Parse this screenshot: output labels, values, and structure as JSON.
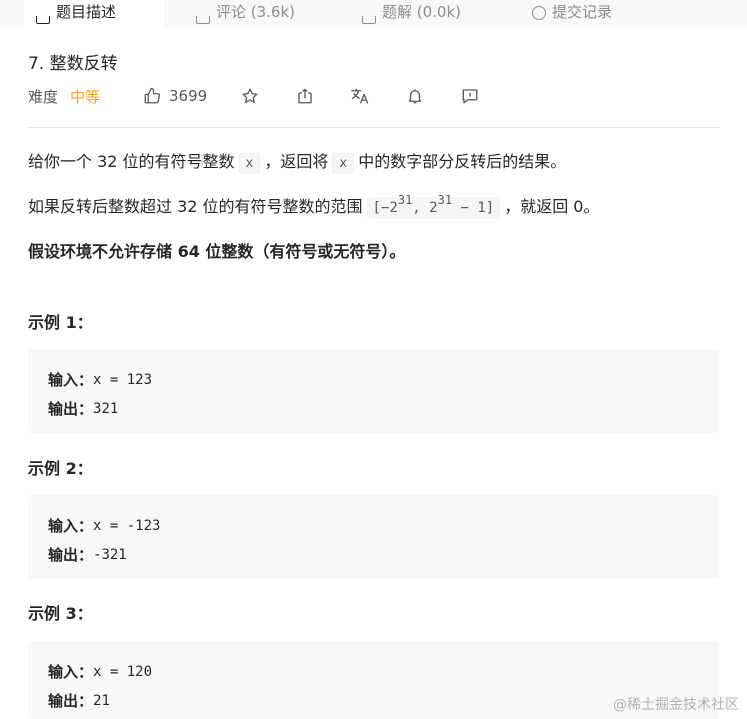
{
  "tabs": [
    {
      "label": "题目描述",
      "active": true
    },
    {
      "label": "评论 (3.6k)",
      "active": false
    },
    {
      "label": "题解 (0.0k)",
      "active": false
    },
    {
      "label": "提交记录",
      "active": false
    }
  ],
  "problem": {
    "title": "7. 整数反转",
    "difficulty_label": "难度",
    "difficulty": "中等",
    "likes": "3699"
  },
  "icons": [
    "thumb-up-icon",
    "star-icon",
    "share-icon",
    "translate-icon",
    "bell-icon",
    "feedback-icon"
  ],
  "description": {
    "p1_a": "给你一个 32 位的有符号整数",
    "p1_code1": "x",
    "p1_b": "，返回将",
    "p1_code2": "x",
    "p1_c": "中的数字部分反转后的结果。",
    "p2_a": "如果反转后整数超过 32 位的有符号整数的范围",
    "p2_range_open": "[−2",
    "p2_exp1": "31",
    "p2_range_mid": ",  2",
    "p2_exp2": "31",
    "p2_range_close": " − 1]",
    "p2_b": "，就返回 0。",
    "p3": "假设环境不允许存储 64 位整数（有符号或无符号）。"
  },
  "examples": [
    {
      "title": "示例 1：",
      "input_label": "输入：",
      "input": "x = 123",
      "output_label": "输出：",
      "output": "321"
    },
    {
      "title": "示例 2：",
      "input_label": "输入：",
      "input": "x = -123",
      "output_label": "输出：",
      "output": "-321"
    },
    {
      "title": "示例 3：",
      "input_label": "输入：",
      "input": "x = 120",
      "output_label": "输出：",
      "output": "21"
    }
  ],
  "watermark": "@稀土掘金技术社区",
  "colors": {
    "accent": "#ffa116",
    "code_bg": "#f7f8fa",
    "text": "#262626",
    "muted": "#595959"
  }
}
